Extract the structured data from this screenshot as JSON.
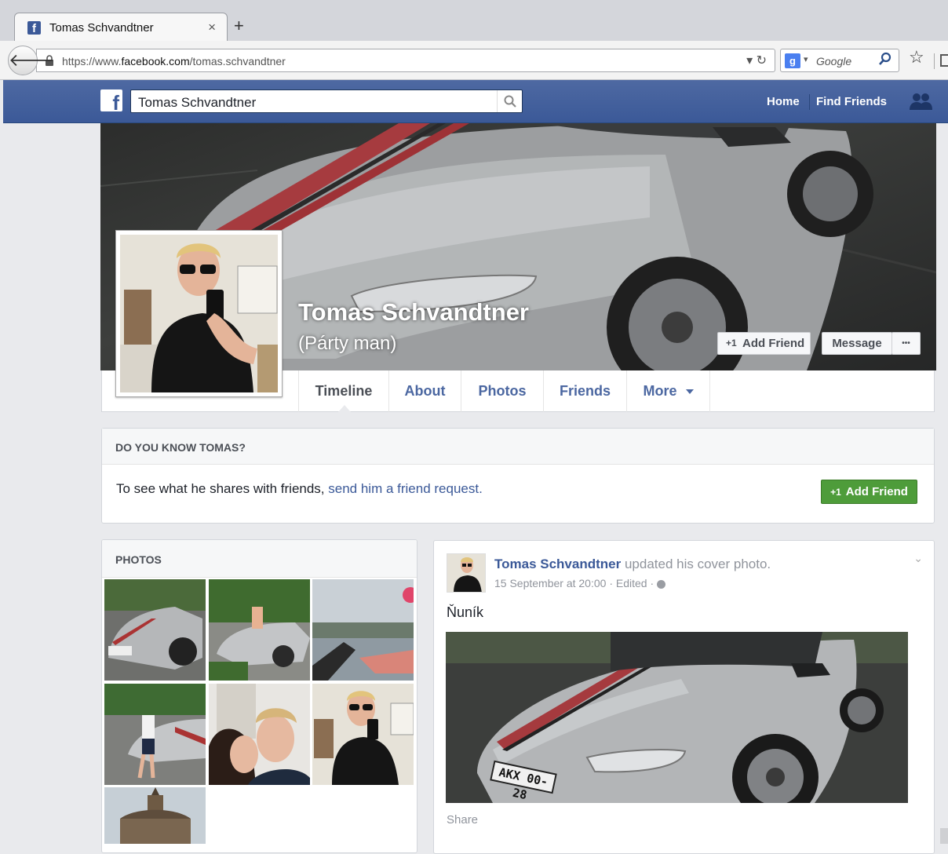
{
  "browser": {
    "tab_title": "Tomas Schvandtner",
    "tab_close": "×",
    "new_tab": "+",
    "url_prefix": "https://www.",
    "url_domain": "facebook.com",
    "url_path": "/tomas.schvandtner",
    "search_engine_placeholder": "Google"
  },
  "fb_header": {
    "logo": "f",
    "search_value": "Tomas Schvandtner",
    "nav_home": "Home",
    "nav_find_friends": "Find Friends"
  },
  "profile": {
    "name": "Tomas Schvandtner",
    "nickname": "(Párty man)",
    "add_friend": "Add Friend",
    "message": "Message",
    "more_dots": "•••",
    "tabs": [
      "Timeline",
      "About",
      "Photos",
      "Friends",
      "More"
    ]
  },
  "know_box": {
    "heading": "DO YOU KNOW TOMAS?",
    "text": "To see what he shares with friends,",
    "link": "send him a friend request.",
    "button": "Add Friend"
  },
  "photos_box": {
    "heading": "PHOTOS"
  },
  "post": {
    "author": "Tomas Schvandtner",
    "action": "updated his cover photo.",
    "meta": "15 September at 20:00 · Edited ·",
    "text": "Ňuník",
    "plate": "AKX 00-28",
    "share": "Share"
  }
}
